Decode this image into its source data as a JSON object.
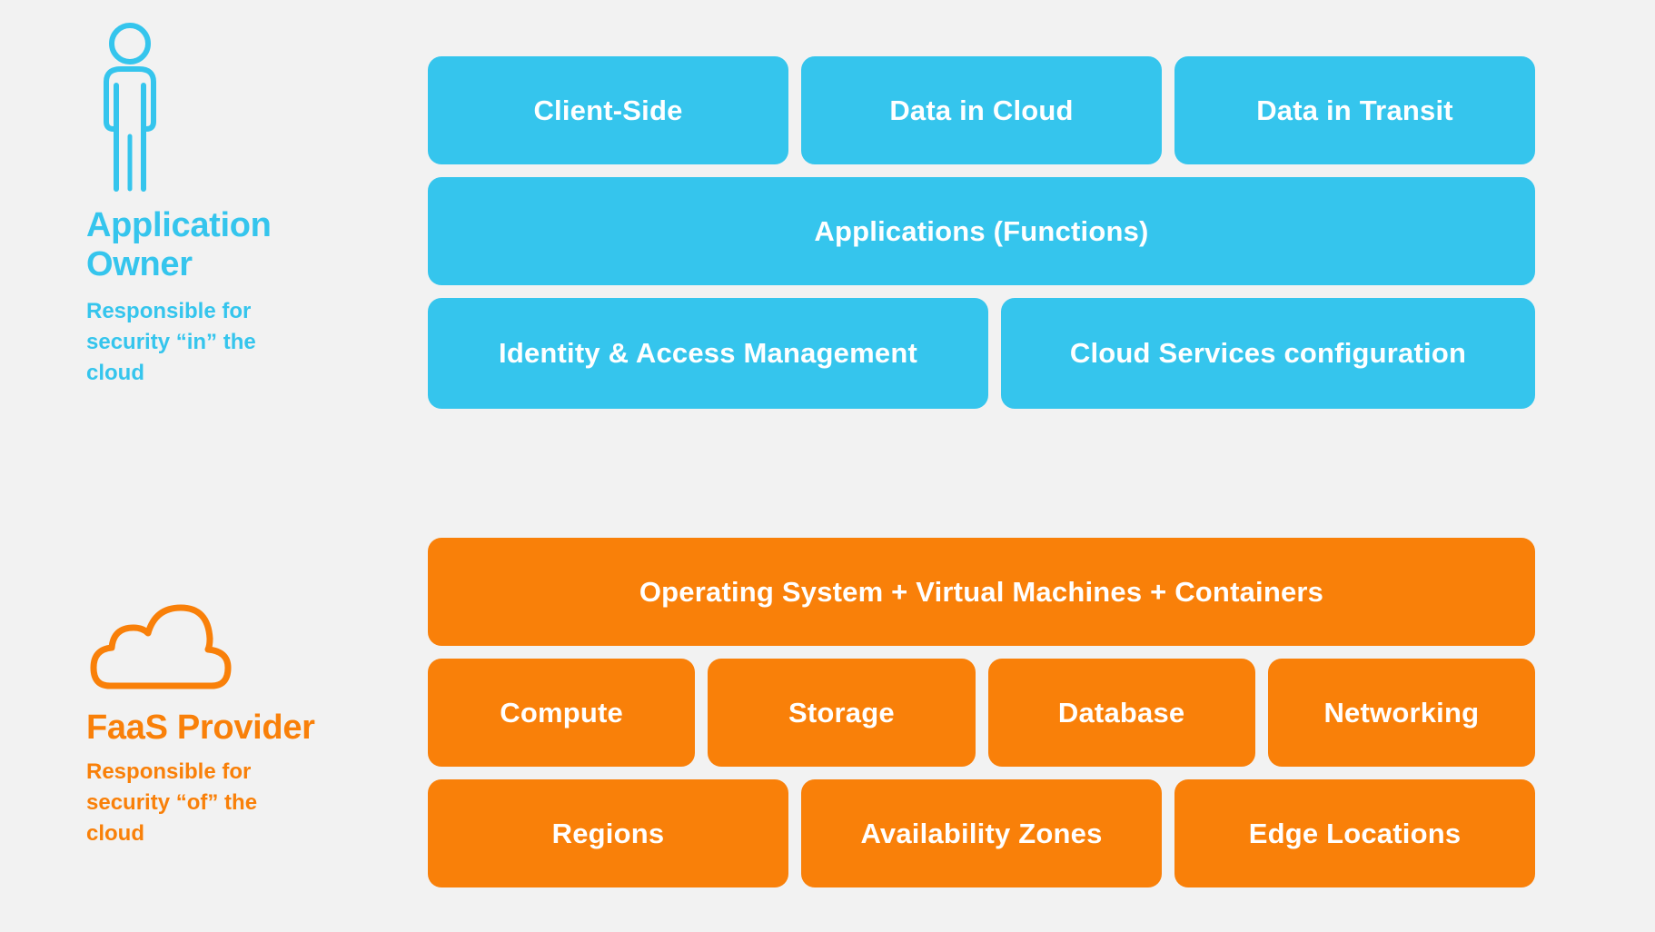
{
  "background_color": "#f2f2f2",
  "colors": {
    "consumer": "#35c5ed",
    "provider": "#f98009",
    "box_text": "#ffffff"
  },
  "legend": {
    "owner": {
      "icon": "person-icon",
      "title": "Application Owner",
      "subtitle": "Responsible for security “in” the cloud"
    },
    "provider": {
      "icon": "cloud-icon",
      "title": "FaaS Provider",
      "subtitle": "Responsible for security “of” the cloud"
    }
  },
  "responsibility_stacks": [
    {
      "owner": "Application Owner",
      "accent": "#35c5ed",
      "rows": [
        {
          "items": [
            "Client-Side",
            "Data in Cloud",
            "Data in Transit"
          ]
        },
        {
          "items": [
            "Applications (Functions)"
          ]
        },
        {
          "items": [
            "Identity & Access Management",
            "Cloud Services configuration"
          ]
        }
      ]
    },
    {
      "owner": "FaaS Provider",
      "accent": "#f98009",
      "rows": [
        {
          "items": [
            "Operating System + Virtual Machines + Containers"
          ]
        },
        {
          "items": [
            "Compute",
            "Storage",
            "Database",
            "Networking"
          ]
        },
        {
          "items": [
            "Regions",
            "Availability Zones",
            "Edge Locations"
          ]
        }
      ]
    }
  ]
}
